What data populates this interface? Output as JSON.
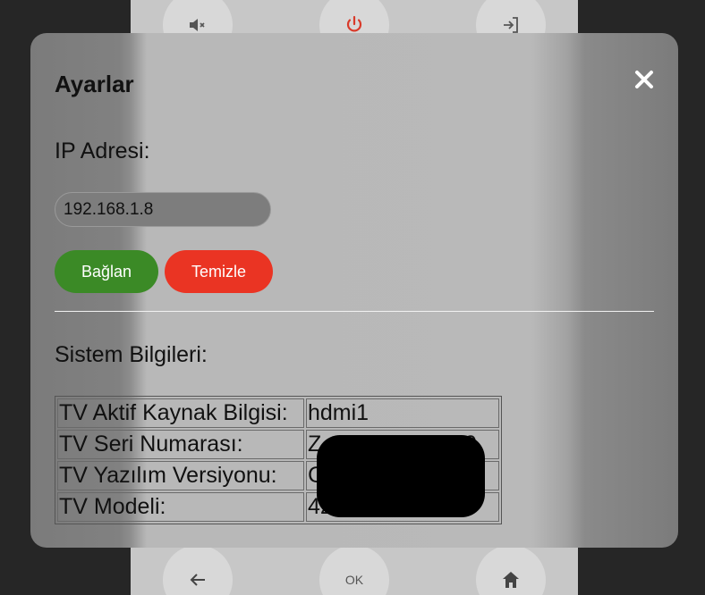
{
  "remote": {
    "ok_label": "OK",
    "icons": [
      "mute-icon",
      "power-icon",
      "input-source-icon",
      "back-arrow-icon",
      "home-icon"
    ],
    "power_color": "#d93a2a"
  },
  "modal": {
    "title": "Ayarlar",
    "close_icon": "close-icon",
    "ip_label": "IP Adresi:",
    "ip_value": "192.168.1.8",
    "connect_label": "Bağlan",
    "clear_label": "Temizle",
    "system_label": "Sistem Bilgileri:",
    "colors": {
      "connect": "#3b8a26",
      "clear": "#ea3423"
    }
  },
  "system_info": [
    {
      "key": "TV Aktif Kaynak Bilgisi:",
      "value": "hdmi1"
    },
    {
      "key": "TV Seri Numarası:",
      "value": "Z                     50"
    },
    {
      "key": "TV Yazılım Versiyonu:",
      "value": "C"
    },
    {
      "key": "TV Modeli:",
      "value": "42                    2"
    }
  ]
}
